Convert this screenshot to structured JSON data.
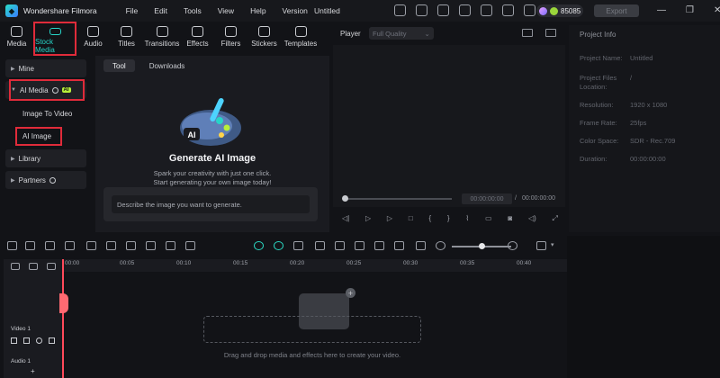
{
  "app": {
    "name": "Wondershare Filmora",
    "document_title": "Untitled",
    "credits": "85085",
    "export_label": "Export"
  },
  "menu": [
    "File",
    "Edit",
    "Tools",
    "View",
    "Help",
    "Version"
  ],
  "toolbar": [
    {
      "label": "Media",
      "icon": "media-icon"
    },
    {
      "label": "Stock Media",
      "icon": "stock-media-icon",
      "active": true
    },
    {
      "label": "Audio",
      "icon": "audio-icon"
    },
    {
      "label": "Titles",
      "icon": "titles-icon"
    },
    {
      "label": "Transitions",
      "icon": "transitions-icon"
    },
    {
      "label": "Effects",
      "icon": "effects-icon"
    },
    {
      "label": "Filters",
      "icon": "filters-icon"
    },
    {
      "label": "Stickers",
      "icon": "stickers-icon"
    },
    {
      "label": "Templates",
      "icon": "templates-icon"
    }
  ],
  "sidebar": {
    "mine": "Mine",
    "ai_media": "AI Media",
    "ai_badge": "AI",
    "image_to_video": "Image To Video",
    "ai_image": "AI Image",
    "library": "Library",
    "partners": "Partners"
  },
  "content": {
    "tabs": [
      "Tool",
      "Downloads"
    ],
    "title": "Generate AI Image",
    "desc1": "Spark your creativity with just one click.",
    "desc2": "Start generating your own image today!",
    "prompt_placeholder": "Describe the image you want to generate.",
    "hero_badge": "AI"
  },
  "player": {
    "label": "Player",
    "quality": "Full Quality",
    "current_time": "00:00:00:00",
    "separator": "/",
    "total_time": "00:00:00:00"
  },
  "project_info": {
    "title": "Project Info",
    "rows": [
      {
        "label": "Project Name:",
        "value": "Untitled"
      },
      {
        "label": "Project Files Location:",
        "value": "/"
      },
      {
        "label": "Resolution:",
        "value": "1920 x 1080"
      },
      {
        "label": "Frame Rate:",
        "value": "25fps"
      },
      {
        "label": "Color Space:",
        "value": "SDR - Rec.709"
      },
      {
        "label": "Duration:",
        "value": "00:00:00:00"
      }
    ]
  },
  "timeline": {
    "ticks": [
      "00:00",
      "00:05",
      "00:10",
      "00:15",
      "00:20",
      "00:25",
      "00:30",
      "00:35",
      "00:40"
    ],
    "video_track": "Video 1",
    "audio_track": "Audio 1",
    "drop_text": "Drag and drop media and effects here to create your video.",
    "zoom_level": 0.5
  },
  "colors": {
    "accent": "#27d4c8",
    "highlight_box": "#e02b3a",
    "playhead": "#ff4a5a",
    "ai_badge": "#b7ef3a"
  }
}
